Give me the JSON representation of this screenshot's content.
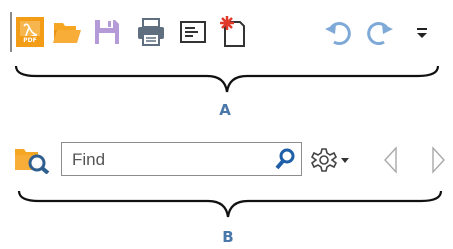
{
  "toolbar_a": {
    "caption": "A",
    "items": [
      {
        "name": "new-pdf-button",
        "icon": "pdf-file-icon"
      },
      {
        "name": "open-button",
        "icon": "folder-open-icon"
      },
      {
        "name": "save-button",
        "icon": "floppy-disk-icon"
      },
      {
        "name": "print-button",
        "icon": "printer-icon"
      },
      {
        "name": "properties-button",
        "icon": "document-properties-icon"
      },
      {
        "name": "new-blank-button",
        "icon": "new-page-star-icon"
      },
      {
        "name": "undo-button",
        "icon": "undo-arrow-icon"
      },
      {
        "name": "redo-button",
        "icon": "redo-arrow-icon"
      },
      {
        "name": "customize-toolbar-button",
        "icon": "overflow-menu-icon"
      }
    ]
  },
  "toolbar_b": {
    "caption": "B",
    "find_placeholder": "Find",
    "items": [
      {
        "name": "advanced-search-button",
        "icon": "folder-search-icon"
      },
      {
        "name": "find-search-button",
        "icon": "magnifier-icon"
      },
      {
        "name": "search-options-button",
        "icon": "gear-dropdown-icon"
      },
      {
        "name": "previous-result-button",
        "icon": "triangle-left-icon"
      },
      {
        "name": "next-result-button",
        "icon": "triangle-right-icon"
      }
    ]
  },
  "colors": {
    "pdf_orange": "#f39c16",
    "folder_orange": "#f5a623",
    "save_lavender": "#b49ad6",
    "printer_gray": "#5f6f7f",
    "arrow_blue": "#7fa9d6",
    "new_red": "#e0392b",
    "caption_blue": "#4a77a9",
    "brace": "#111111"
  }
}
